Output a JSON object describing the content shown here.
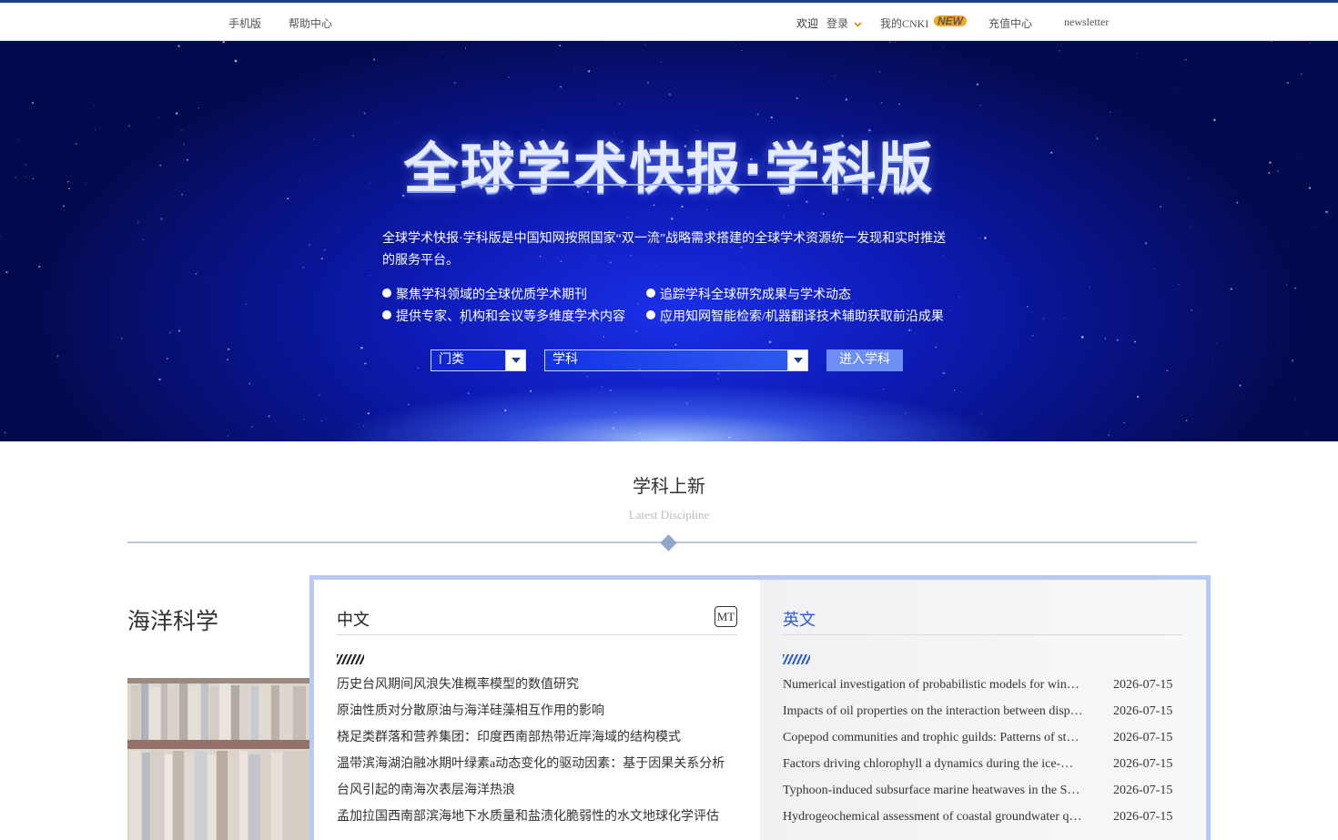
{
  "topbar": {
    "mobile": "手机版",
    "help": "帮助中心",
    "welcome": "欢迎",
    "login": "登录",
    "my_cnki": "我的CNKI",
    "new_badge": "NEW",
    "recharge": "充值中心",
    "newsletter": "newsletter"
  },
  "hero": {
    "title": "全球学术快报·学科版",
    "description": "全球学术快报·学科版是中国知网按照国家“双一流”战略需求搭建的全球学术资源统一发现和实时推送的服务平台。",
    "bullets": [
      "聚焦学科领域的全球优质学术期刊",
      "追踪学科全球研究成果与学术动态",
      "提供专家、机构和会议等多维度学术内容",
      "应用知网智能检索/机器翻译技术辅助获取前沿成果"
    ],
    "category_select": "门类",
    "subject_select": "学科",
    "enter_button": "进入学科"
  },
  "section": {
    "title": "学科上新",
    "subtitle": "Latest Discipline"
  },
  "discipline": {
    "name": "海洋科学",
    "cn_header": "中文",
    "mt_label": "MT",
    "en_header": "英文",
    "cn_articles": [
      "历史台风期间风浪失准概率模型的数值研究",
      "原油性质对分散原油与海洋硅藻相互作用的影响",
      "桡足类群落和营养集团：印度西南部热带近岸海域的结构模式",
      "温带滨海湖泊融冰期叶绿素a动态变化的驱动因素：基于因果关系分析",
      "台风引起的南海次表层海洋热浪",
      "孟加拉国西南部滨海地下水质量和盐渍化脆弱性的水文地球化学评估",
      "…"
    ],
    "en_articles": [
      {
        "title": "Numerical investigation of probabilistic models for win…",
        "date": "2026-07-15"
      },
      {
        "title": "Impacts of oil properties on the interaction between disp…",
        "date": "2026-07-15"
      },
      {
        "title": "Copepod communities and trophic guilds: Patterns of st…",
        "date": "2026-07-15"
      },
      {
        "title": "Factors driving chlorophyll a dynamics during the ice-…",
        "date": "2026-07-15"
      },
      {
        "title": "Typhoon-induced subsurface marine heatwaves in the S…",
        "date": "2026-07-15"
      },
      {
        "title": "Hydrogeochemical assessment of coastal groundwater q…",
        "date": "2026-07-15"
      }
    ]
  }
}
